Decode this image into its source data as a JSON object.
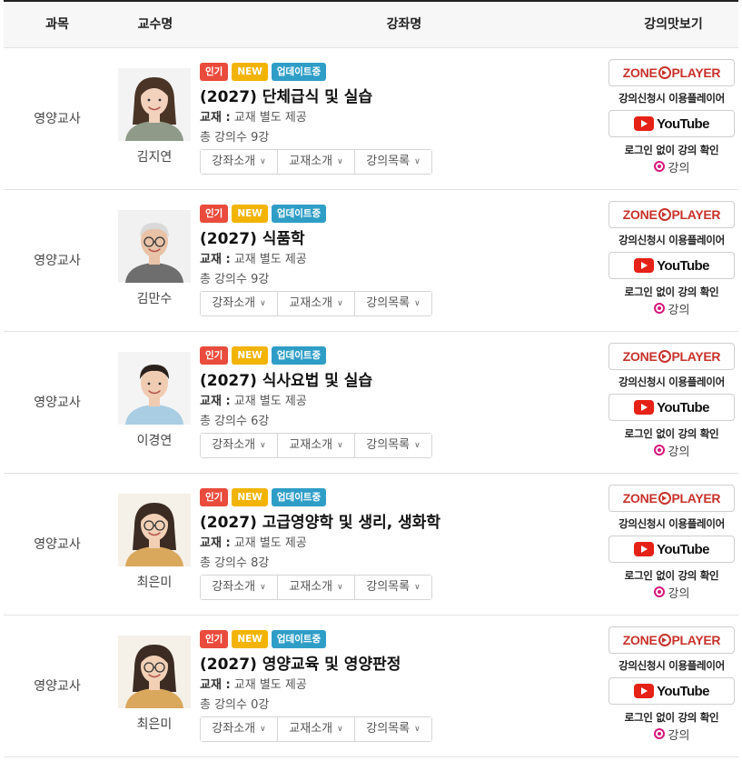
{
  "header": {
    "subject": "과목",
    "professor": "교수명",
    "course": "강좌명",
    "preview": "강의맛보기"
  },
  "labels": {
    "badge_popular": "인기",
    "badge_new": "NEW",
    "badge_updating": "업데이트중",
    "material_label": "교재 :",
    "material_value": "교재 별도 제공",
    "dd_intro": "강좌소개",
    "dd_book": "교재소개",
    "dd_list": "강의목록",
    "zone_player_pre": "ZONE",
    "zone_player_post": "PLAYER",
    "player_caption": "강의신청시 이용플레이어",
    "youtube": "YouTube",
    "login_caption": "로그인 없이 강의 확인",
    "lecture_link": "강의"
  },
  "colors": {
    "badge_popular": "#e94b3c",
    "badge_new": "#f2b400",
    "badge_updating": "#2f9ec7",
    "zone_red": "#c8322b",
    "youtube_red": "#e62117",
    "radio_pink": "#d6177b"
  },
  "courses": [
    {
      "subject": "영양교사",
      "professor": "김지연",
      "title": "(2027) 단체급식 및 실습",
      "count": "총 강의수 9강"
    },
    {
      "subject": "영양교사",
      "professor": "김만수",
      "title": "(2027) 식품학",
      "count": "총 강의수 9강"
    },
    {
      "subject": "영양교사",
      "professor": "이경연",
      "title": "(2027) 식사요법 및 실습",
      "count": "총 강의수 6강"
    },
    {
      "subject": "영양교사",
      "professor": "최은미",
      "title": "(2027) 고급영양학 및 생리, 생화학",
      "count": "총 강의수 8강"
    },
    {
      "subject": "영양교사",
      "professor": "최은미",
      "title": "(2027) 영양교육 및 영양판정",
      "count": "총 강의수 0강"
    }
  ]
}
